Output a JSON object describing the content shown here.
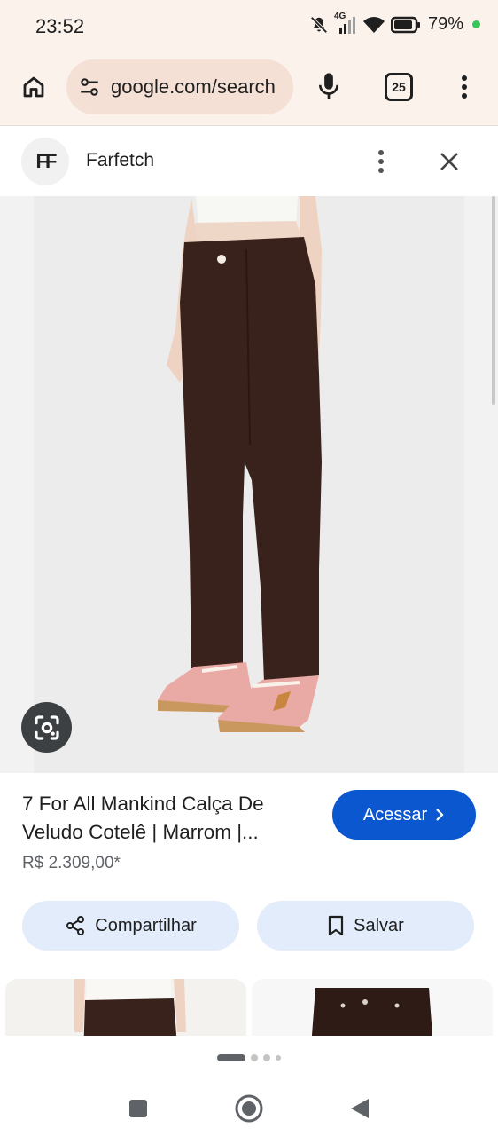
{
  "status_bar": {
    "time": "23:52",
    "network": "4G",
    "battery": "79%"
  },
  "toolbar": {
    "url": "google.com/search",
    "tab_count": "25",
    "icons": [
      "home-icon",
      "tune-icon",
      "mic-icon",
      "tabs-icon",
      "more-vert-icon"
    ]
  },
  "source": {
    "logo": "FF",
    "name": "Farfetch"
  },
  "product": {
    "title": "7 For All Mankind Calça De Veludo Cotelê | Marrom |...",
    "price": "R$ 2.309,00*",
    "visit_label": "Acessar",
    "share_label": "Compartilhar",
    "save_label": "Salvar"
  },
  "colors": {
    "chrome_bg": "#fbf2ec",
    "url_pill": "#f5e0d5",
    "primary": "#0b57d0",
    "tonal_button": "#e3ecfa",
    "pants": "#3a221c",
    "sneaker": "#e9a9a4"
  },
  "pagination": {
    "pages": 4,
    "active": 1
  }
}
